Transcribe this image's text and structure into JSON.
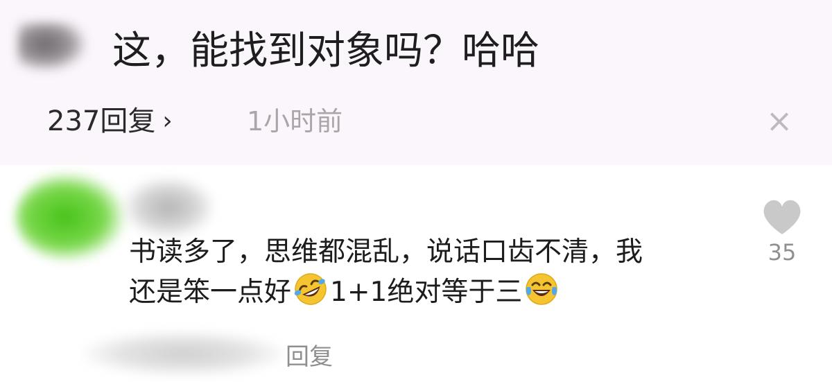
{
  "parent_comment": {
    "text": "这，能找到对象吗？哈哈",
    "replies_label": "237回复",
    "replies_chevron": "›",
    "time": "1小时前",
    "close_symbol": "×"
  },
  "reply_comment": {
    "text_line1": "书读多了，思维都混乱，说话口齿不清，我",
    "text_line2_part1": "还是笨一点好",
    "text_line2_part2": "1+1绝对等于三",
    "like_count": "35",
    "reply_label": "回复"
  },
  "colors": {
    "like_icon": "#c9c9c9",
    "emoji_face": "#f5c531",
    "emoji_tear": "#52a8e8"
  },
  "icons": {
    "like": "heart-icon",
    "emoji_1": "rolling-laughing-emoji",
    "emoji_2": "tears-of-joy-emoji",
    "close": "close-icon"
  }
}
